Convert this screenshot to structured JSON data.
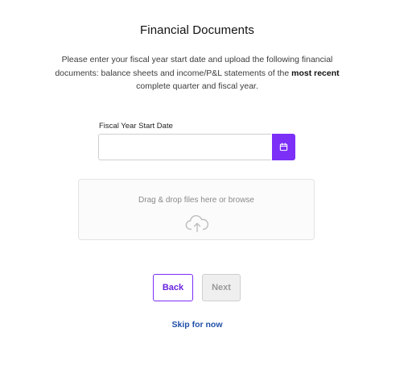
{
  "header": {
    "title": "Financial Documents"
  },
  "description": {
    "part1": "Please enter your fiscal year start date and upload the following financial documents: balance sheets and income/P&L statements of the ",
    "emphasis": "most recent",
    "part2": " complete quarter and fiscal year."
  },
  "fiscal_year": {
    "label": "Fiscal Year Start Date",
    "value": "",
    "placeholder": "",
    "calendar_icon": "calendar-icon"
  },
  "upload": {
    "text": "Drag & drop files here or browse",
    "icon": "cloud-upload-icon"
  },
  "actions": {
    "back_label": "Back",
    "next_label": "Next",
    "skip_label": "Skip for now"
  },
  "colors": {
    "accent": "#7b2ff7",
    "link": "#1f4fa8",
    "disabled_bg": "#efefef"
  }
}
